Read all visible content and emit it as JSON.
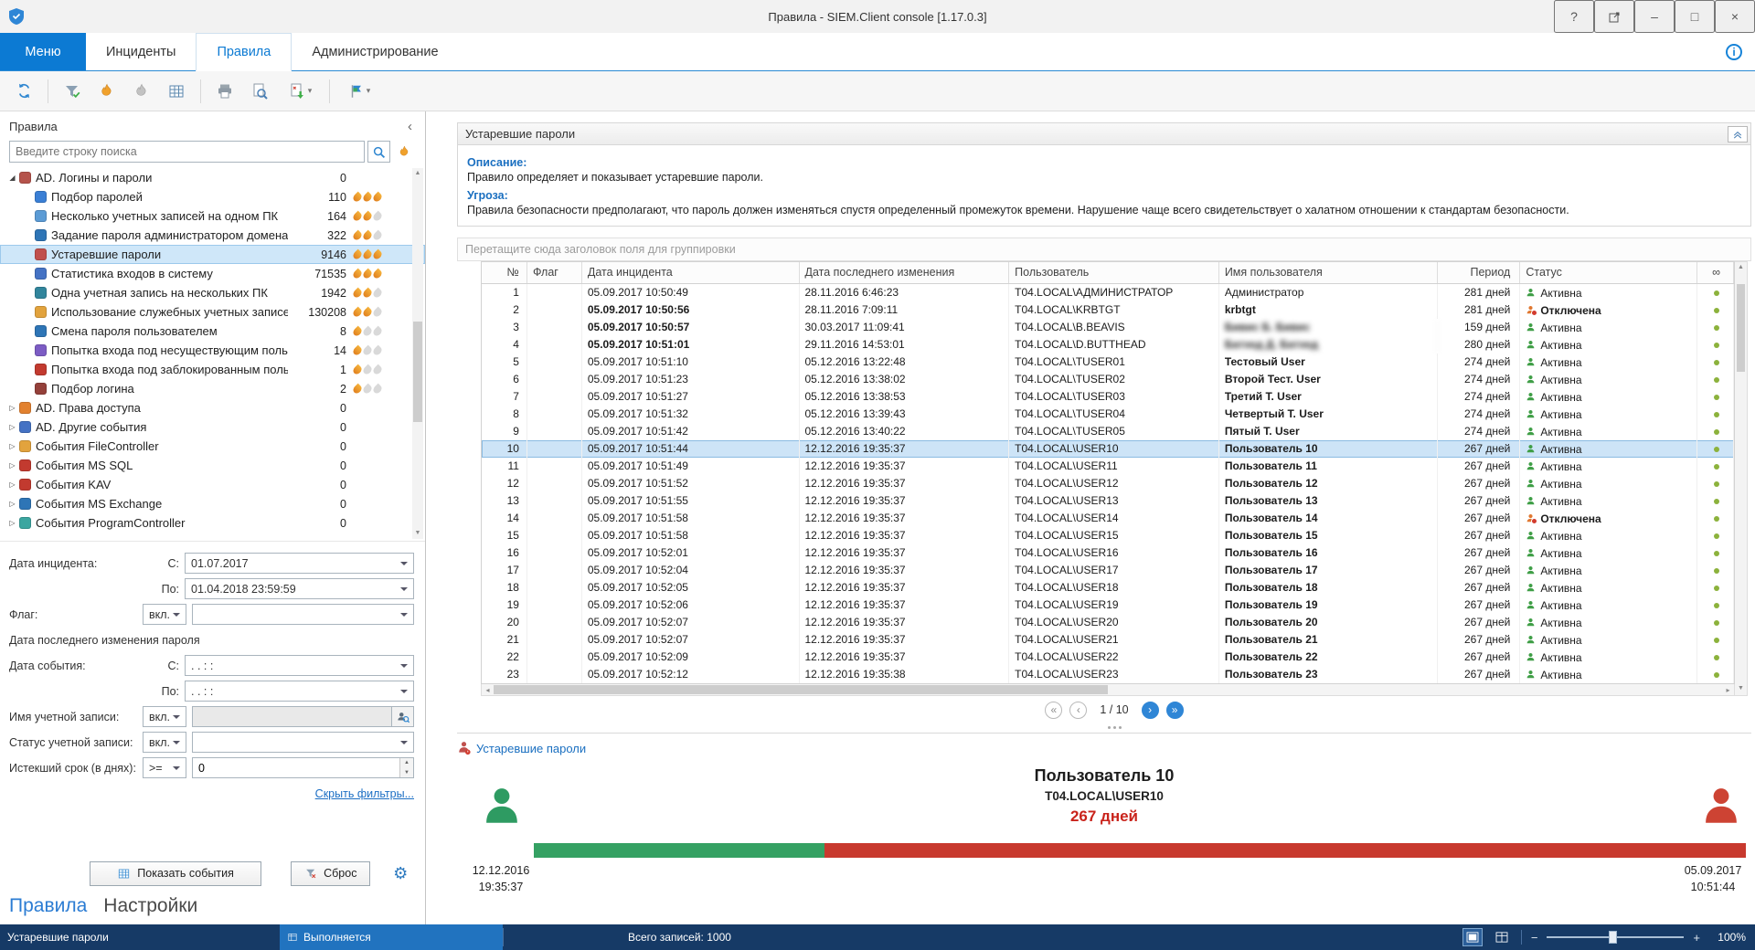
{
  "window": {
    "title": "Правила - SIEM.Client console [1.17.0.3]"
  },
  "icons": {
    "help": "?",
    "minimize": "–",
    "maximize": "□",
    "close": "×",
    "caret": "▾",
    "sidebar_collapse": "‹",
    "gear": "⚙",
    "first": "«",
    "prev": "‹",
    "next": "›",
    "last": "»"
  },
  "colors": {
    "accent": "#0c7ad3",
    "selected_row": "#cde4f7",
    "active_green": "#3f9e46",
    "disabled_orange": "#e0772f",
    "days_red": "#c9231b",
    "bar_green": "#35a163",
    "bar_red": "#c8392e",
    "statusbar": "#163a66",
    "running_segment": "#2173bf"
  },
  "tabs": {
    "menu_label": "Меню",
    "items": [
      {
        "label": "Инциденты"
      },
      {
        "label": "Правила",
        "active": true
      },
      {
        "label": "Администрирование"
      }
    ]
  },
  "sidebar": {
    "title": "Правила",
    "search": {
      "placeholder": "Введите строку поиска"
    },
    "tree": [
      {
        "label": "AD. Логины и пароли",
        "count": "0",
        "level": 0,
        "state": "expanded",
        "icon": "credentials-icon",
        "color": "#b5534b"
      },
      {
        "label": "Подбор паролей",
        "count": "110",
        "level": 1,
        "icon": "password-guess-icon",
        "color": "#3a7fd5",
        "flames": 3
      },
      {
        "label": "Несколько учетных записей на одном ПК",
        "count": "164",
        "level": 1,
        "icon": "multi-accounts-icon",
        "color": "#5b9bd5",
        "flames": 2
      },
      {
        "label": "Задание пароля администратором домена",
        "count": "322",
        "level": 1,
        "icon": "admin-set-password-icon",
        "color": "#2e75b6",
        "flames": 2
      },
      {
        "label": "Устаревшие пароли",
        "count": "9146",
        "level": 1,
        "icon": "outdated-passwords-icon",
        "color": "#c0504d",
        "flames": 3,
        "selected": true
      },
      {
        "label": "Статистика входов в систему",
        "count": "71535",
        "level": 1,
        "icon": "login-stats-icon",
        "color": "#4472c4",
        "flames": 3
      },
      {
        "label": "Одна учетная запись на нескольких ПК",
        "count": "1942",
        "level": 1,
        "icon": "account-multi-pc-icon",
        "color": "#31859c",
        "flames": 2
      },
      {
        "label": "Использование служебных учетных записей",
        "count": "130208",
        "level": 1,
        "icon": "service-accounts-icon",
        "color": "#e2a33d",
        "flames": 2
      },
      {
        "label": "Смена пароля пользователем",
        "count": "8",
        "level": 1,
        "icon": "password-change-icon",
        "color": "#2e75b6",
        "flames": 1
      },
      {
        "label": "Попытка входа под несуществующим польз",
        "count": "14",
        "level": 1,
        "icon": "nonexistent-login-icon",
        "color": "#7c5cc4",
        "flames": 1
      },
      {
        "label": "Попытка входа под заблокированным поль",
        "count": "1",
        "level": 1,
        "icon": "blocked-login-icon",
        "color": "#c23a2f",
        "flames": 1
      },
      {
        "label": "Подбор логина",
        "count": "2",
        "level": 1,
        "icon": "login-guess-icon",
        "color": "#94403a",
        "flames": 1
      },
      {
        "label": "AD. Права доступа",
        "count": "0",
        "level": 0,
        "state": "collapsed",
        "icon": "access-rights-icon",
        "color": "#e2812f"
      },
      {
        "label": "AD. Другие события",
        "count": "0",
        "level": 0,
        "state": "collapsed",
        "icon": "other-events-icon",
        "color": "#4472c4"
      },
      {
        "label": "События FileController",
        "count": "0",
        "level": 0,
        "state": "collapsed",
        "icon": "filecontroller-icon",
        "color": "#e2a33d"
      },
      {
        "label": "События MS SQL",
        "count": "0",
        "level": 0,
        "state": "collapsed",
        "icon": "mssql-icon",
        "color": "#c23a2f"
      },
      {
        "label": "События KAV",
        "count": "0",
        "level": 0,
        "state": "collapsed",
        "icon": "kav-icon",
        "color": "#c23a2f"
      },
      {
        "label": "События MS Exchange",
        "count": "0",
        "level": 0,
        "state": "collapsed",
        "icon": "exchange-icon",
        "color": "#2e75b6"
      },
      {
        "label": "События ProgramController",
        "count": "0",
        "level": 0,
        "state": "collapsed",
        "icon": "programcontroller-icon",
        "color": "#3ba6a0"
      }
    ],
    "filters": {
      "incident_date_label": "Дата инцидента:",
      "from_label": "С:",
      "to_label": "По:",
      "incident_from": "01.07.2017",
      "incident_to": "01.04.2018 23:59:59",
      "flag_label": "Флаг:",
      "mode_on": "вкл.",
      "pwd_change_section": "Дата последнего изменения пароля",
      "event_date_label": "Дата события:",
      "empty_datetime": ". .    : :",
      "account_name_label": "Имя учетной записи:",
      "account_status_label": "Статус учетной записи:",
      "expired_label": "Истекший срок (в днях):",
      "expired_op": ">=",
      "expired_value": "0",
      "hide_filters_link": "Скрыть фильтры...",
      "show_events_button": "Показать события",
      "reset_button": "Сброс"
    },
    "bottom_tabs": {
      "rules": "Правила",
      "settings": "Настройки"
    }
  },
  "main": {
    "panel_title": "Устаревшие пароли",
    "description_label": "Описание:",
    "description": "Правило определяет и показывает устаревшие пароли.",
    "threat_label": "Угроза:",
    "threat": "Правила безопасности предполагают, что пароль должен изменяться спустя определенный промежуток времени. Нарушение чаще всего свидетельствует о халатном отношении к стандартам безопасности.",
    "group_hint": "Перетащите сюда заголовок поля для группировки",
    "table": {
      "columns": [
        "№",
        "Флаг",
        "Дата инцидента",
        "Дата последнего изменения",
        "Пользователь",
        "Имя пользователя",
        "Период",
        "Статус",
        "∞"
      ],
      "rows": [
        {
          "n": "1",
          "incident": "05.09.2017 10:50:49",
          "changed": "28.11.2016 6:46:23",
          "user": "T04.LOCAL\\АДМИНИСТРАТОР",
          "name": "Администратор",
          "period": "281 дней",
          "status": "Активна"
        },
        {
          "n": "2",
          "incident": "05.09.2017 10:50:56",
          "changed": "28.11.2016 7:09:11",
          "user": "T04.LOCAL\\KRBTGT",
          "name": "krbtgt",
          "period": "281 дней",
          "status": "Отключена",
          "bold": true,
          "name_bold": true,
          "disabled": true
        },
        {
          "n": "3",
          "incident": "05.09.2017 10:50:57",
          "changed": "30.03.2017 11:09:41",
          "user": "T04.LOCAL\\B.BEAVIS",
          "name": "Бивис Б. Бивис",
          "period": "159 дней",
          "status": "Активна",
          "bold": true,
          "name_bold": true,
          "blurred": true
        },
        {
          "n": "4",
          "incident": "05.09.2017 10:51:01",
          "changed": "29.11.2016 14:53:01",
          "user": "T04.LOCAL\\D.BUTTHEAD",
          "name": "Батхед Д. Батхед",
          "period": "280 дней",
          "status": "Активна",
          "bold": true,
          "name_bold": true,
          "blurred": true
        },
        {
          "n": "5",
          "incident": "05.09.2017 10:51:10",
          "changed": "05.12.2016 13:22:48",
          "user": "T04.LOCAL\\TUSER01",
          "name": "Тестовый User",
          "period": "274 дней",
          "status": "Активна",
          "name_bold": true
        },
        {
          "n": "6",
          "incident": "05.09.2017 10:51:23",
          "changed": "05.12.2016 13:38:02",
          "user": "T04.LOCAL\\TUSER02",
          "name": "Второй Тест. User",
          "period": "274 дней",
          "status": "Активна",
          "name_bold": true
        },
        {
          "n": "7",
          "incident": "05.09.2017 10:51:27",
          "changed": "05.12.2016 13:38:53",
          "user": "T04.LOCAL\\TUSER03",
          "name": "Третий T. User",
          "period": "274 дней",
          "status": "Активна",
          "name_bold": true
        },
        {
          "n": "8",
          "incident": "05.09.2017 10:51:32",
          "changed": "05.12.2016 13:39:43",
          "user": "T04.LOCAL\\TUSER04",
          "name": "Четвертый T. User",
          "period": "274 дней",
          "status": "Активна",
          "name_bold": true
        },
        {
          "n": "9",
          "incident": "05.09.2017 10:51:42",
          "changed": "05.12.2016 13:40:22",
          "user": "T04.LOCAL\\TUSER05",
          "name": "Пятый T. User",
          "period": "274 дней",
          "status": "Активна",
          "name_bold": true
        },
        {
          "n": "10",
          "incident": "05.09.2017 10:51:44",
          "changed": "12.12.2016 19:35:37",
          "user": "T04.LOCAL\\USER10",
          "name": "Пользователь 10",
          "period": "267 дней",
          "status": "Активна",
          "name_bold": true,
          "selected": true
        },
        {
          "n": "11",
          "incident": "05.09.2017 10:51:49",
          "changed": "12.12.2016 19:35:37",
          "user": "T04.LOCAL\\USER11",
          "name": "Пользователь 11",
          "period": "267 дней",
          "status": "Активна",
          "name_bold": true
        },
        {
          "n": "12",
          "incident": "05.09.2017 10:51:52",
          "changed": "12.12.2016 19:35:37",
          "user": "T04.LOCAL\\USER12",
          "name": "Пользователь 12",
          "period": "267 дней",
          "status": "Активна",
          "name_bold": true
        },
        {
          "n": "13",
          "incident": "05.09.2017 10:51:55",
          "changed": "12.12.2016 19:35:37",
          "user": "T04.LOCAL\\USER13",
          "name": "Пользователь 13",
          "period": "267 дней",
          "status": "Активна",
          "name_bold": true
        },
        {
          "n": "14",
          "incident": "05.09.2017 10:51:58",
          "changed": "12.12.2016 19:35:37",
          "user": "T04.LOCAL\\USER14",
          "name": "Пользователь 14",
          "period": "267 дней",
          "status": "Отключена",
          "name_bold": true,
          "disabled": true
        },
        {
          "n": "15",
          "incident": "05.09.2017 10:51:58",
          "changed": "12.12.2016 19:35:37",
          "user": "T04.LOCAL\\USER15",
          "name": "Пользователь 15",
          "period": "267 дней",
          "status": "Активна",
          "name_bold": true
        },
        {
          "n": "16",
          "incident": "05.09.2017 10:52:01",
          "changed": "12.12.2016 19:35:37",
          "user": "T04.LOCAL\\USER16",
          "name": "Пользователь 16",
          "period": "267 дней",
          "status": "Активна",
          "name_bold": true
        },
        {
          "n": "17",
          "incident": "05.09.2017 10:52:04",
          "changed": "12.12.2016 19:35:37",
          "user": "T04.LOCAL\\USER17",
          "name": "Пользователь 17",
          "period": "267 дней",
          "status": "Активна",
          "name_bold": true
        },
        {
          "n": "18",
          "incident": "05.09.2017 10:52:05",
          "changed": "12.12.2016 19:35:37",
          "user": "T04.LOCAL\\USER18",
          "name": "Пользователь 18",
          "period": "267 дней",
          "status": "Активна",
          "name_bold": true
        },
        {
          "n": "19",
          "incident": "05.09.2017 10:52:06",
          "changed": "12.12.2016 19:35:37",
          "user": "T04.LOCAL\\USER19",
          "name": "Пользователь 19",
          "period": "267 дней",
          "status": "Активна",
          "name_bold": true
        },
        {
          "n": "20",
          "incident": "05.09.2017 10:52:07",
          "changed": "12.12.2016 19:35:37",
          "user": "T04.LOCAL\\USER20",
          "name": "Пользователь 20",
          "period": "267 дней",
          "status": "Активна",
          "name_bold": true
        },
        {
          "n": "21",
          "incident": "05.09.2017 10:52:07",
          "changed": "12.12.2016 19:35:37",
          "user": "T04.LOCAL\\USER21",
          "name": "Пользователь 21",
          "period": "267 дней",
          "status": "Активна",
          "name_bold": true
        },
        {
          "n": "22",
          "incident": "05.09.2017 10:52:09",
          "changed": "12.12.2016 19:35:37",
          "user": "T04.LOCAL\\USER22",
          "name": "Пользователь 22",
          "period": "267 дней",
          "status": "Активна",
          "name_bold": true
        },
        {
          "n": "23",
          "incident": "05.09.2017 10:52:12",
          "changed": "12.12.2016 19:35:38",
          "user": "T04.LOCAL\\USER23",
          "name": "Пользователь 23",
          "period": "267 дней",
          "status": "Активна",
          "name_bold": true
        }
      ]
    },
    "pagination": {
      "label": "1 / 10"
    },
    "detail": {
      "title": "Устаревшие пароли",
      "user_name": "Пользователь 10",
      "account": "T04.LOCAL\\USER10",
      "days": "267 дней",
      "start_date": "12.12.2016",
      "start_time": "19:35:37",
      "end_date": "05.09.2017",
      "end_time": "10:51:44",
      "green_pct": 24
    }
  },
  "statusbar": {
    "rule": "Устаревшие пароли",
    "state": "Выполняется",
    "total": "Всего записей: 1000",
    "zoom": "100%"
  }
}
